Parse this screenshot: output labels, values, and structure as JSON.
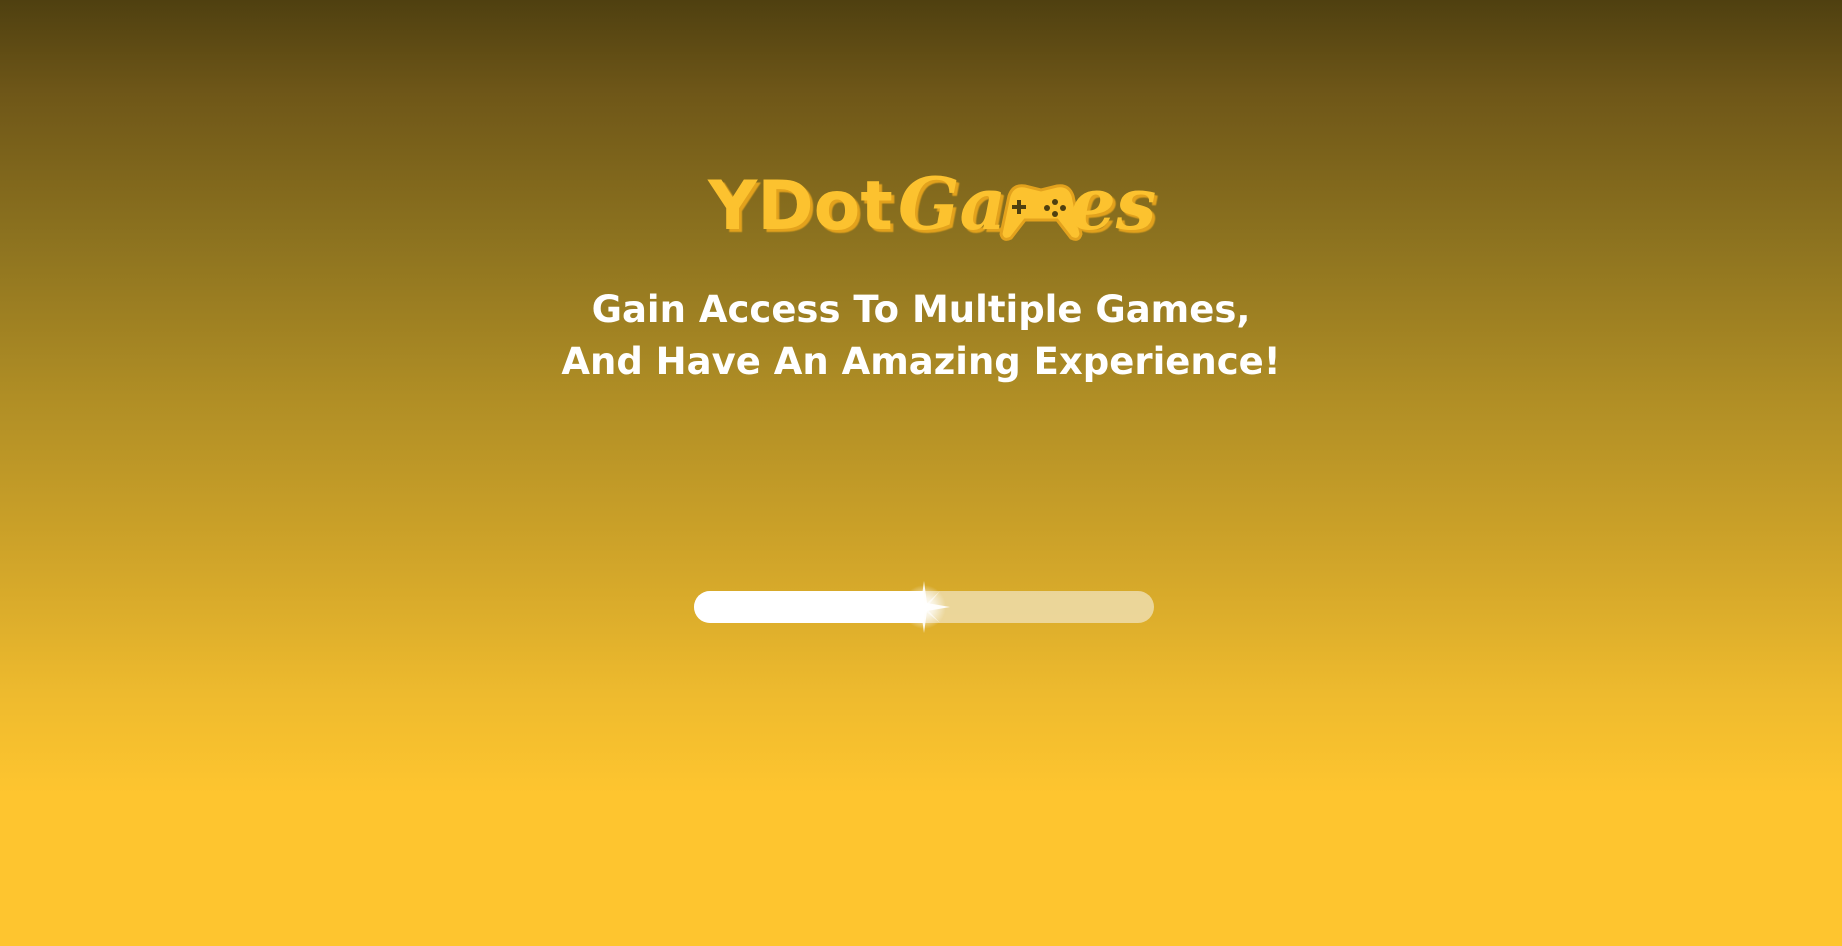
{
  "logo": {
    "text_part1": "YDot",
    "text_part2_prefix": "Ga",
    "text_part2_suffix": "es",
    "icon": "gamepad-icon",
    "color": "#fcc22f",
    "shadow_color": "#e3a21d"
  },
  "tagline": {
    "line1": "Gain Access To Multiple Games,",
    "line2": "And Have An Amazing Experience!"
  },
  "progress": {
    "value": 0.5,
    "fill_color": "#ffffff",
    "track_color": "#f0e1b9"
  },
  "colors": {
    "background_top": "#4f4010",
    "background_bottom": "#fec52f",
    "text": "#ffffff"
  }
}
